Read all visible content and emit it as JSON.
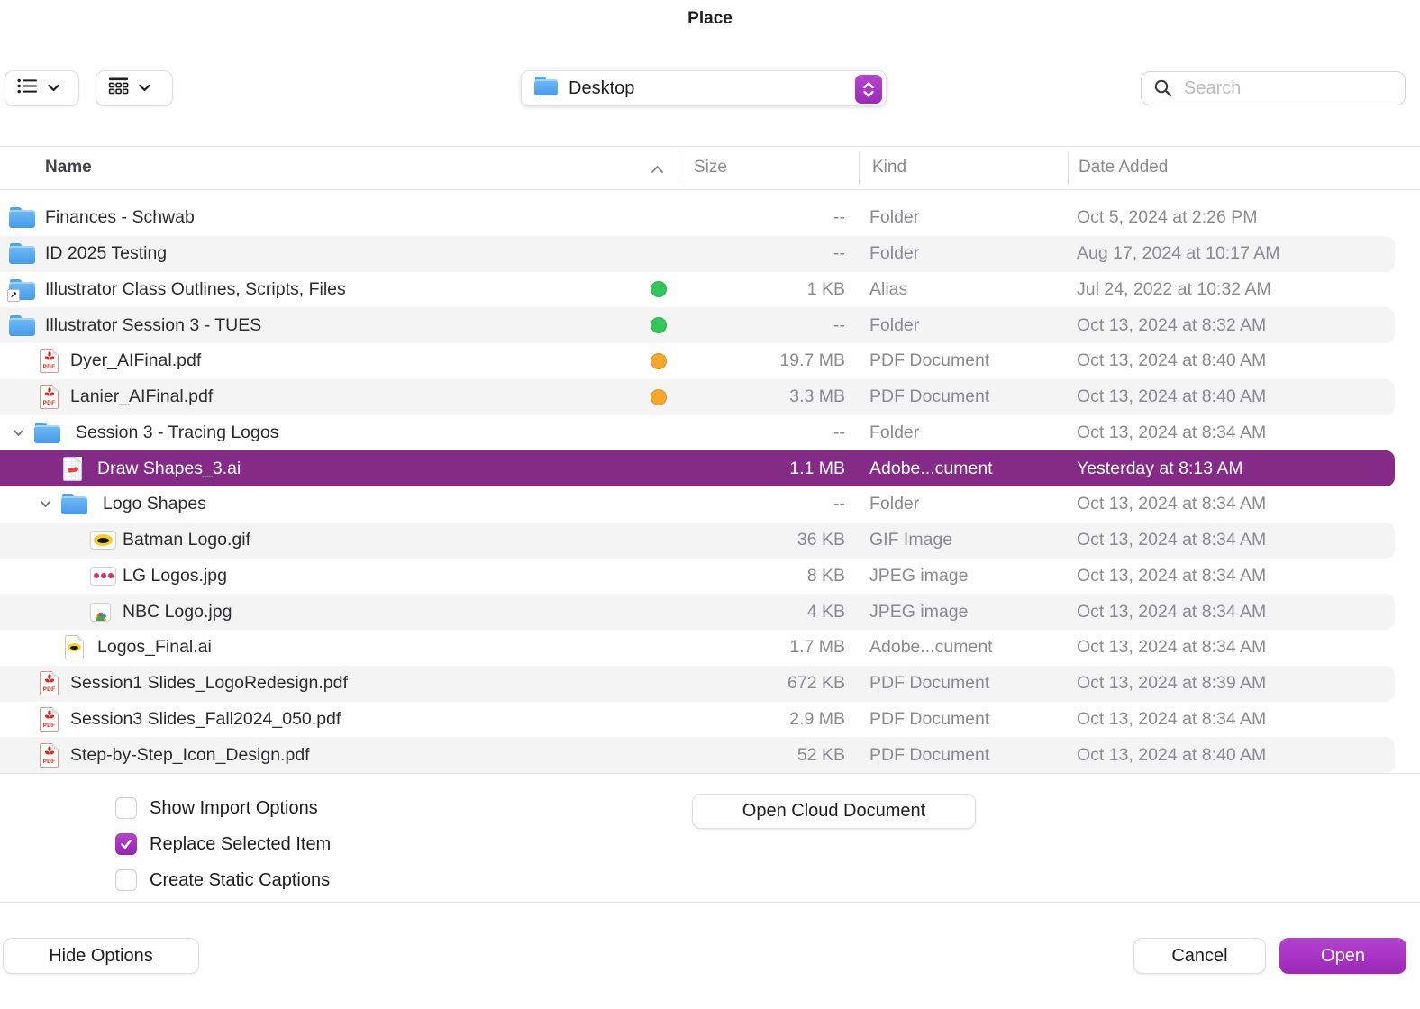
{
  "dialog": {
    "title": "Place"
  },
  "toolbar": {
    "view_buttons": [
      {
        "name": "list-view",
        "icon": "list-icon"
      },
      {
        "name": "group-view",
        "icon": "grid-icon"
      }
    ],
    "path_selector": {
      "value": "Desktop",
      "icon": "folder-icon"
    },
    "search": {
      "placeholder": "Search",
      "icon": "search-icon"
    }
  },
  "table": {
    "columns": [
      {
        "label": "Name",
        "sort": "asc"
      },
      {
        "label": "Size"
      },
      {
        "label": "Kind"
      },
      {
        "label": "Date Added"
      }
    ],
    "rows": [
      {
        "name": "Finances - Schwab",
        "size": "--",
        "kind": "Folder",
        "date": "Oct 5, 2024 at 2:26 PM",
        "icon": "folder",
        "preset": "folder0",
        "tag": null,
        "selected": false
      },
      {
        "name": "ID 2025 Testing",
        "size": "--",
        "kind": "Folder",
        "date": "Aug 17, 2024 at 10:17 AM",
        "icon": "folder",
        "preset": "folder0",
        "tag": null,
        "selected": false
      },
      {
        "name": "Illustrator Class Outlines, Scripts, Files",
        "size": "1 KB",
        "kind": "Alias",
        "date": "Jul 24, 2022 at 10:32 AM",
        "icon": "folder-alias",
        "preset": "folder0",
        "tag": "green",
        "selected": false
      },
      {
        "name": "Illustrator Session 3 - TUES",
        "size": "--",
        "kind": "Folder",
        "date": "Oct 13, 2024 at 8:32 AM",
        "icon": "folder",
        "preset": "folder0",
        "tag": "green",
        "selected": false
      },
      {
        "name": "Dyer_AIFinal.pdf",
        "size": "19.7 MB",
        "kind": "PDF Document",
        "date": "Oct 13, 2024 at 8:40 AM",
        "icon": "pdf",
        "preset": "file0",
        "tag": "orange",
        "selected": false
      },
      {
        "name": "Lanier_AIFinal.pdf",
        "size": "3.3 MB",
        "kind": "PDF Document",
        "date": "Oct 13, 2024 at 8:40 AM",
        "icon": "pdf",
        "preset": "file0",
        "tag": "orange",
        "selected": false
      },
      {
        "name": "Session 3 - Tracing Logos",
        "size": "--",
        "kind": "Folder",
        "date": "Oct 13, 2024 at 8:34 AM",
        "icon": "folder",
        "preset": "folder0open",
        "tag": null,
        "selected": false
      },
      {
        "name": "Draw Shapes_3.ai",
        "size": "1.1 MB",
        "kind": "Adobe...cument",
        "date": "Yesterday at 8:13 AM",
        "icon": "ai-grid",
        "preset": "file1",
        "tag": null,
        "selected": true
      },
      {
        "name": "Logo Shapes",
        "size": "--",
        "kind": "Folder",
        "date": "Oct 13, 2024 at 8:34 AM",
        "icon": "folder",
        "preset": "folder1open",
        "tag": null,
        "selected": false
      },
      {
        "name": "Batman Logo.gif",
        "size": "36 KB",
        "kind": "GIF Image",
        "date": "Oct 13, 2024 at 8:34 AM",
        "icon": "thumb-batman",
        "preset": "file2",
        "tag": null,
        "selected": false
      },
      {
        "name": "LG Logos.jpg",
        "size": "8 KB",
        "kind": "JPEG image",
        "date": "Oct 13, 2024 at 8:34 AM",
        "icon": "thumb-lg",
        "preset": "file2",
        "tag": null,
        "selected": false
      },
      {
        "name": "NBC Logo.jpg",
        "size": "4 KB",
        "kind": "JPEG image",
        "date": "Oct 13, 2024 at 8:34 AM",
        "icon": "thumb-nbc",
        "preset": "file2",
        "tag": null,
        "selected": false
      },
      {
        "name": "Logos_Final.ai",
        "size": "1.7 MB",
        "kind": "Adobe...cument",
        "date": "Oct 13, 2024 at 8:34 AM",
        "icon": "ai-bat",
        "preset": "file1b",
        "tag": null,
        "selected": false
      },
      {
        "name": "Session1 Slides_LogoRedesign.pdf",
        "size": "672 KB",
        "kind": "PDF Document",
        "date": "Oct 13, 2024 at 8:39 AM",
        "icon": "pdf",
        "preset": "file0",
        "tag": null,
        "selected": false
      },
      {
        "name": "Session3 Slides_Fall2024_050.pdf",
        "size": "2.9 MB",
        "kind": "PDF Document",
        "date": "Oct 13, 2024 at 8:34 AM",
        "icon": "pdf",
        "preset": "file0",
        "tag": null,
        "selected": false
      },
      {
        "name": "Step-by-Step_Icon_Design.pdf",
        "size": "52 KB",
        "kind": "PDF Document",
        "date": "Oct 13, 2024 at 8:40 AM",
        "icon": "pdf",
        "preset": "file0",
        "tag": null,
        "selected": false
      }
    ]
  },
  "options": {
    "checkboxes": [
      {
        "label": "Show Import Options",
        "checked": false
      },
      {
        "label": "Replace Selected Item",
        "checked": true
      },
      {
        "label": "Create Static Captions",
        "checked": false
      }
    ],
    "open_cloud_label": "Open Cloud Document"
  },
  "footer": {
    "hide_options_label": "Hide Options",
    "cancel_label": "Cancel",
    "open_label": "Open"
  },
  "colors": {
    "selection_purple": "#832b85",
    "accent_magenta": "#a435c0",
    "tag_green": "#33c759",
    "tag_orange": "#f7a62c",
    "zebra_gray": "#f4f4f5",
    "folder_blue": "#479aeb"
  }
}
